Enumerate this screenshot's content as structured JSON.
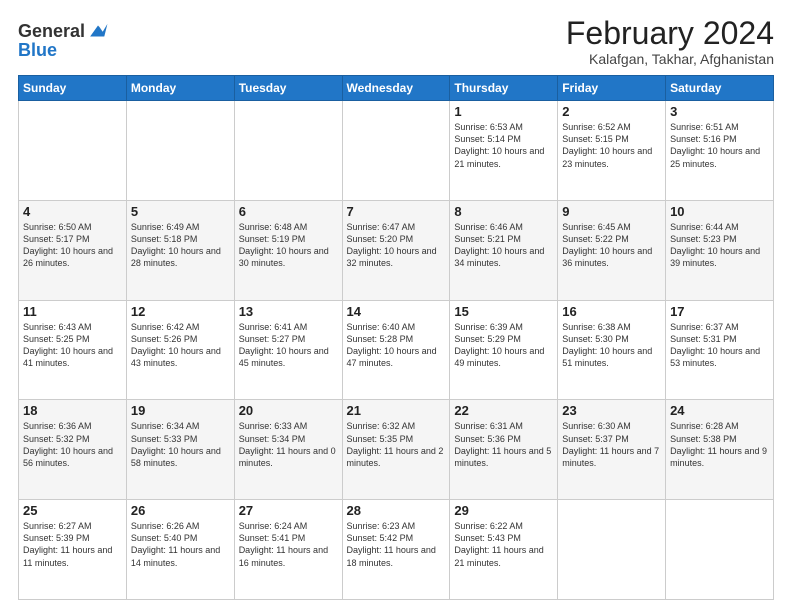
{
  "logo": {
    "line1": "General",
    "line2": "Blue"
  },
  "title": "February 2024",
  "subtitle": "Kalafgan, Takhar, Afghanistan",
  "weekdays": [
    "Sunday",
    "Monday",
    "Tuesday",
    "Wednesday",
    "Thursday",
    "Friday",
    "Saturday"
  ],
  "weeks": [
    [
      {
        "day": "",
        "info": ""
      },
      {
        "day": "",
        "info": ""
      },
      {
        "day": "",
        "info": ""
      },
      {
        "day": "",
        "info": ""
      },
      {
        "day": "1",
        "info": "Sunrise: 6:53 AM\nSunset: 5:14 PM\nDaylight: 10 hours and 21 minutes."
      },
      {
        "day": "2",
        "info": "Sunrise: 6:52 AM\nSunset: 5:15 PM\nDaylight: 10 hours and 23 minutes."
      },
      {
        "day": "3",
        "info": "Sunrise: 6:51 AM\nSunset: 5:16 PM\nDaylight: 10 hours and 25 minutes."
      }
    ],
    [
      {
        "day": "4",
        "info": "Sunrise: 6:50 AM\nSunset: 5:17 PM\nDaylight: 10 hours and 26 minutes."
      },
      {
        "day": "5",
        "info": "Sunrise: 6:49 AM\nSunset: 5:18 PM\nDaylight: 10 hours and 28 minutes."
      },
      {
        "day": "6",
        "info": "Sunrise: 6:48 AM\nSunset: 5:19 PM\nDaylight: 10 hours and 30 minutes."
      },
      {
        "day": "7",
        "info": "Sunrise: 6:47 AM\nSunset: 5:20 PM\nDaylight: 10 hours and 32 minutes."
      },
      {
        "day": "8",
        "info": "Sunrise: 6:46 AM\nSunset: 5:21 PM\nDaylight: 10 hours and 34 minutes."
      },
      {
        "day": "9",
        "info": "Sunrise: 6:45 AM\nSunset: 5:22 PM\nDaylight: 10 hours and 36 minutes."
      },
      {
        "day": "10",
        "info": "Sunrise: 6:44 AM\nSunset: 5:23 PM\nDaylight: 10 hours and 39 minutes."
      }
    ],
    [
      {
        "day": "11",
        "info": "Sunrise: 6:43 AM\nSunset: 5:25 PM\nDaylight: 10 hours and 41 minutes."
      },
      {
        "day": "12",
        "info": "Sunrise: 6:42 AM\nSunset: 5:26 PM\nDaylight: 10 hours and 43 minutes."
      },
      {
        "day": "13",
        "info": "Sunrise: 6:41 AM\nSunset: 5:27 PM\nDaylight: 10 hours and 45 minutes."
      },
      {
        "day": "14",
        "info": "Sunrise: 6:40 AM\nSunset: 5:28 PM\nDaylight: 10 hours and 47 minutes."
      },
      {
        "day": "15",
        "info": "Sunrise: 6:39 AM\nSunset: 5:29 PM\nDaylight: 10 hours and 49 minutes."
      },
      {
        "day": "16",
        "info": "Sunrise: 6:38 AM\nSunset: 5:30 PM\nDaylight: 10 hours and 51 minutes."
      },
      {
        "day": "17",
        "info": "Sunrise: 6:37 AM\nSunset: 5:31 PM\nDaylight: 10 hours and 53 minutes."
      }
    ],
    [
      {
        "day": "18",
        "info": "Sunrise: 6:36 AM\nSunset: 5:32 PM\nDaylight: 10 hours and 56 minutes."
      },
      {
        "day": "19",
        "info": "Sunrise: 6:34 AM\nSunset: 5:33 PM\nDaylight: 10 hours and 58 minutes."
      },
      {
        "day": "20",
        "info": "Sunrise: 6:33 AM\nSunset: 5:34 PM\nDaylight: 11 hours and 0 minutes."
      },
      {
        "day": "21",
        "info": "Sunrise: 6:32 AM\nSunset: 5:35 PM\nDaylight: 11 hours and 2 minutes."
      },
      {
        "day": "22",
        "info": "Sunrise: 6:31 AM\nSunset: 5:36 PM\nDaylight: 11 hours and 5 minutes."
      },
      {
        "day": "23",
        "info": "Sunrise: 6:30 AM\nSunset: 5:37 PM\nDaylight: 11 hours and 7 minutes."
      },
      {
        "day": "24",
        "info": "Sunrise: 6:28 AM\nSunset: 5:38 PM\nDaylight: 11 hours and 9 minutes."
      }
    ],
    [
      {
        "day": "25",
        "info": "Sunrise: 6:27 AM\nSunset: 5:39 PM\nDaylight: 11 hours and 11 minutes."
      },
      {
        "day": "26",
        "info": "Sunrise: 6:26 AM\nSunset: 5:40 PM\nDaylight: 11 hours and 14 minutes."
      },
      {
        "day": "27",
        "info": "Sunrise: 6:24 AM\nSunset: 5:41 PM\nDaylight: 11 hours and 16 minutes."
      },
      {
        "day": "28",
        "info": "Sunrise: 6:23 AM\nSunset: 5:42 PM\nDaylight: 11 hours and 18 minutes."
      },
      {
        "day": "29",
        "info": "Sunrise: 6:22 AM\nSunset: 5:43 PM\nDaylight: 11 hours and 21 minutes."
      },
      {
        "day": "",
        "info": ""
      },
      {
        "day": "",
        "info": ""
      }
    ]
  ]
}
